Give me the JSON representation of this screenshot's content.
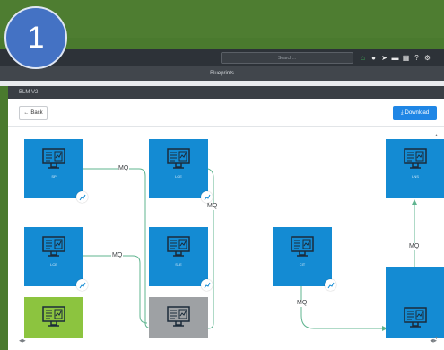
{
  "step_badge": "1",
  "header": {
    "search_placeholder": "Search...",
    "icons": [
      "home-icon",
      "circle-icon",
      "rocket-icon",
      "card-icon",
      "store-icon",
      "help-icon",
      "gear-icon"
    ]
  },
  "page": {
    "section_title": "Blueprints",
    "panel_title": "BLM V2",
    "back_label": "Back",
    "download_label": "Download"
  },
  "nodes": [
    {
      "label": "SP",
      "color": "#148bd3"
    },
    {
      "label": "LCE",
      "color": "#148bd3"
    },
    {
      "label": "LCE",
      "color": "#148bd3"
    },
    {
      "label": "SLE",
      "color": "#148bd3"
    },
    {
      "label": "",
      "color": "#8cc43f"
    },
    {
      "label": "",
      "color": "#9ea1a4"
    },
    {
      "label": "CIT",
      "color": "#148bd3"
    },
    {
      "label": "LNS",
      "color": "#148bd3"
    },
    {
      "label": "",
      "color": "#148bd3"
    }
  ],
  "connections": [
    {
      "label": "MQ"
    },
    {
      "label": "MQ"
    },
    {
      "label": "MQ"
    },
    {
      "label": "MQ"
    },
    {
      "label": "MQ"
    }
  ],
  "colors": {
    "node_blue": "#148bd3",
    "node_green": "#8cc43f",
    "node_gray": "#9ea1a4",
    "line": "#5fb48f",
    "download": "#1f86e5"
  }
}
